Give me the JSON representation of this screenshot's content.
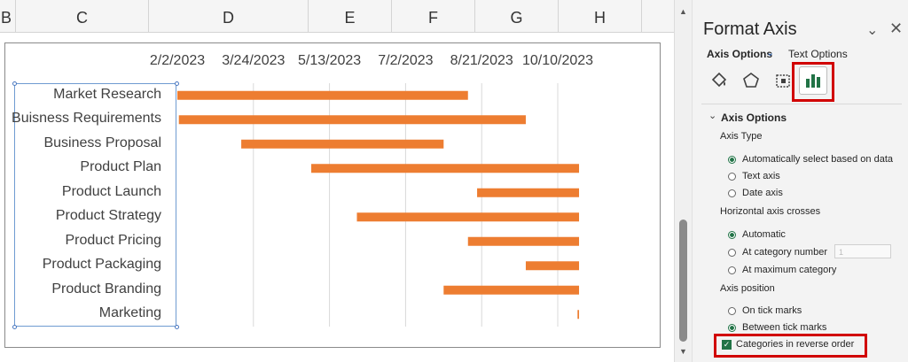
{
  "columns": [
    "B",
    "C",
    "D",
    "E",
    "F",
    "G",
    "H"
  ],
  "chart": {
    "date_axis_labels": [
      "2/2/2023",
      "3/24/2023",
      "5/13/2023",
      "7/2/2023",
      "8/21/2023",
      "10/10/2023"
    ],
    "tasks": [
      {
        "name": "Market Research",
        "start": "2/2/2023",
        "end": "8/12/2023"
      },
      {
        "name": "Buisness Requirements",
        "start": "2/3/2023",
        "end": "9/19/2023"
      },
      {
        "name": "Business Proposal",
        "start": "3/16/2023",
        "end": "7/27/2023"
      },
      {
        "name": "Product Plan",
        "start": "5/1/2023",
        "end": "10/24/2023"
      },
      {
        "name": "Product Launch",
        "start": "8/18/2023",
        "end": "10/24/2023"
      },
      {
        "name": "Product Strategy",
        "start": "5/31/2023",
        "end": "10/24/2023"
      },
      {
        "name": "Product Pricing",
        "start": "8/12/2023",
        "end": "10/24/2023"
      },
      {
        "name": "Product Packaging",
        "start": "9/19/2023",
        "end": "10/24/2023"
      },
      {
        "name": "Product Branding",
        "start": "7/27/2023",
        "end": "10/24/2023"
      },
      {
        "name": "Marketing",
        "start": "10/23/2023",
        "end": "10/24/2023"
      }
    ],
    "bar_color": "#ED7D31"
  },
  "pane": {
    "title": "Format Axis",
    "tab_axis": "Axis Options",
    "tab_text": "Text Options",
    "section": "Axis Options",
    "axis_type_label": "Axis Type",
    "axis_type_options": [
      "Automatically select based on data",
      "Text axis",
      "Date axis"
    ],
    "axis_type_selected": 0,
    "crosses_label": "Horizontal axis crosses",
    "crosses_options": [
      "Automatic",
      "At category number",
      "At maximum category"
    ],
    "crosses_selected": 0,
    "category_number": "1",
    "position_label": "Axis position",
    "position_options": [
      "On tick marks",
      "Between tick marks"
    ],
    "position_selected": 1,
    "reverse_label": "Categories in reverse order",
    "reverse_checked": true,
    "accent": "#217346",
    "highlight": "#D10000"
  }
}
